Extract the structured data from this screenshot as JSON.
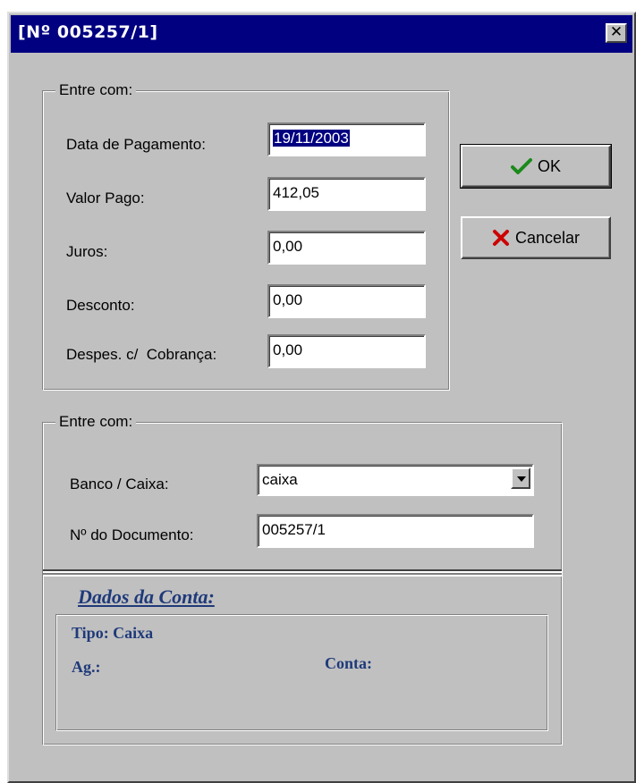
{
  "window": {
    "title": "[Nº 005257/1]",
    "close_glyph": "✕"
  },
  "group1": {
    "legend": "Entre com:",
    "fields": [
      {
        "label": "Data de Pagamento:",
        "value": "19/11/2003"
      },
      {
        "label": "Valor Pago:",
        "value": "412,05"
      },
      {
        "label": "Juros:",
        "value": "0,00"
      },
      {
        "label": "Desconto:",
        "value": "0,00"
      },
      {
        "label": "Despes. c/  Cobrança:",
        "value": "0,00"
      }
    ]
  },
  "buttons": {
    "ok_label": "OK",
    "cancel_label": "Cancelar",
    "ok_icon": "checkmark-icon",
    "cancel_icon": "red-x-icon",
    "ok_icon_color": "#1a8a1a",
    "cancel_icon_color": "#cc0000"
  },
  "group2": {
    "legend": "Entre com:",
    "banco_label": "Banco / Caixa:",
    "banco_value": "caixa",
    "documento_label": "Nº do Documento:",
    "documento_value": "005257/1"
  },
  "dados": {
    "title": "Dados da Conta:",
    "tipo": "Tipo: Caixa",
    "ag": "Ag.:",
    "conta": "Conta:",
    "text_color": "#1f3a7a"
  }
}
